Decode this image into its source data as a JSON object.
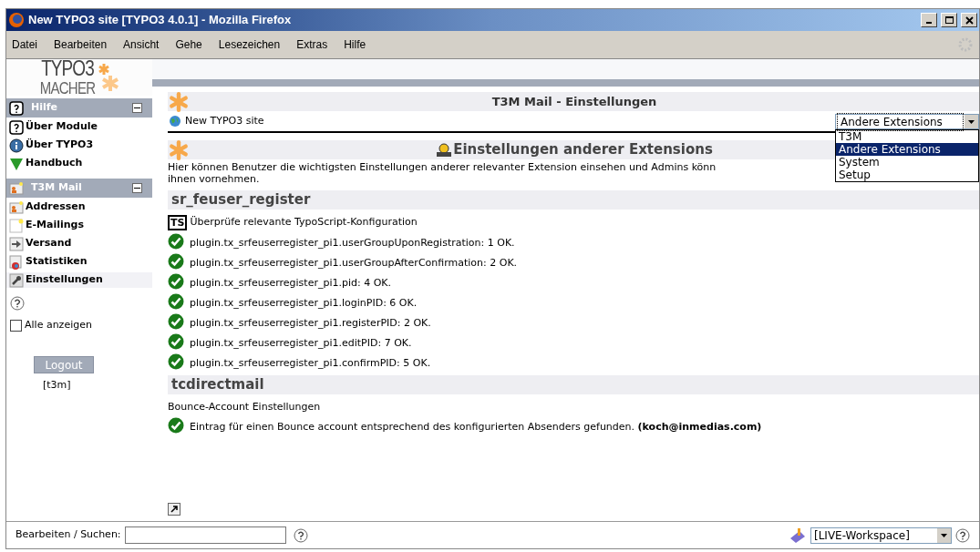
{
  "window": {
    "title": "New TYPO3 site [TYPO3 4.0.1] - Mozilla Firefox"
  },
  "menu": [
    "Datei",
    "Bearbeiten",
    "Ansicht",
    "Gehe",
    "Lesezeichen",
    "Extras",
    "Hilfe"
  ],
  "sidebar": {
    "logo": [
      "TYPO3",
      "MACHER"
    ],
    "sections": [
      {
        "title": "Hilfe",
        "expanded": true,
        "items": [
          {
            "label": "Über Module",
            "kind": "help",
            "selected": false
          },
          {
            "label": "Über TYPO3",
            "kind": "info",
            "selected": false
          },
          {
            "label": "Handbuch",
            "kind": "manual",
            "selected": false
          }
        ]
      },
      {
        "title": "T3M Mail",
        "expanded": true,
        "items": [
          {
            "label": "Addressen",
            "kind": "address",
            "selected": false
          },
          {
            "label": "E-Mailings",
            "kind": "page",
            "selected": false
          },
          {
            "label": "Versand",
            "kind": "send",
            "selected": false
          },
          {
            "label": "Statistiken",
            "kind": "stats",
            "selected": false
          },
          {
            "label": "Einstellungen",
            "kind": "settings",
            "selected": true
          }
        ]
      }
    ],
    "show_all": {
      "label": "Alle anzeigen",
      "checked": false
    },
    "logout": "Logout",
    "user": "[t3m]"
  },
  "main": {
    "title": "T3M Mail - Einstellungen",
    "site": "New TYPO3 site",
    "select": {
      "value": "Andere Extensions",
      "options": [
        {
          "label": "T3M",
          "selected": false
        },
        {
          "label": "Andere Extensions",
          "selected": true
        },
        {
          "label": "System",
          "selected": false
        },
        {
          "label": "Setup",
          "selected": false
        }
      ]
    },
    "section_title": "Einstellungen anderer Extensions",
    "description": [
      "Hier können Benutzer die wichtigsten Einstellungen anderer relevanter Extension einsehen und Admins könn",
      "ihnen vornehmen."
    ],
    "groups": [
      {
        "title": "sr_feuser_register",
        "subtitle": "Überprüfe relevante TypoScript-Konfiguration",
        "badge": "TS",
        "checks": [
          "plugin.tx_srfeuserregister_pi1.userGroupUponRegistration: 1 OK.",
          "plugin.tx_srfeuserregister_pi1.userGroupAfterConfirmation: 2 OK.",
          "plugin.tx_srfeuserregister_pi1.pid: 4 OK.",
          "plugin.tx_srfeuserregister_pi1.loginPID: 6 OK.",
          "plugin.tx_srfeuserregister_pi1.registerPID: 2 OK.",
          "plugin.tx_srfeuserregister_pi1.editPID: 7 OK.",
          "plugin.tx_srfeuserregister_pi1.confirmPID: 5 OK."
        ]
      },
      {
        "title": "tcdirectmail",
        "subtitle": "Bounce-Account Einstellungen",
        "checks": [
          "Eintrag für einen Bounce account entsprechend des konfigurierten Absenders gefunden. **(koch@inmedias.com)**"
        ]
      }
    ]
  },
  "bottom": {
    "search_label": "Bearbeiten / Suchen:",
    "workspace": "[LIVE-Workspace]"
  }
}
